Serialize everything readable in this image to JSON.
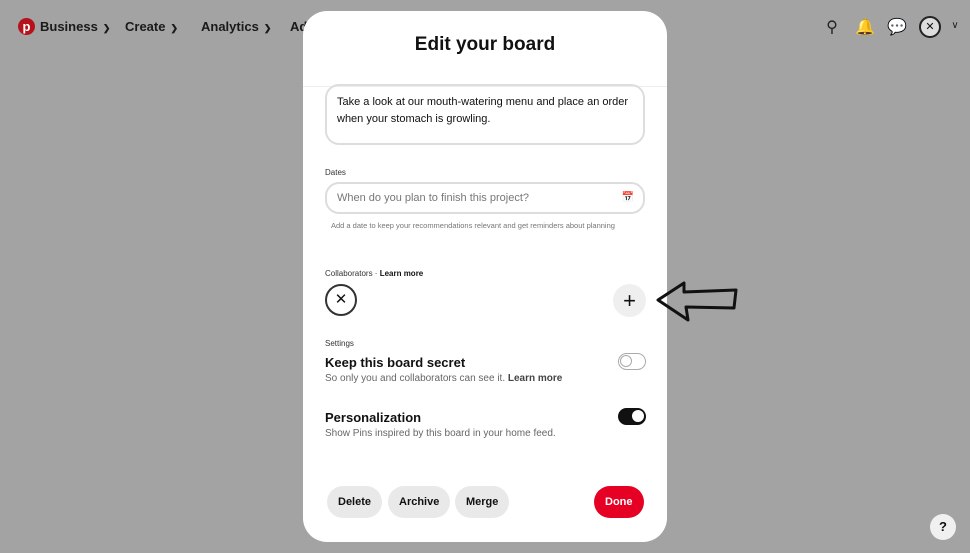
{
  "nav": {
    "items": [
      "Business",
      "Create",
      "Analytics",
      "Ad"
    ]
  },
  "modal": {
    "title": "Edit your board",
    "description": "Take a look at our mouth-watering menu and place an order when your stomach is growling.",
    "dates_label": "Dates",
    "dates_placeholder": "When do you plan to finish this project?",
    "dates_hint": "Add a date to keep your recommendations relevant and get reminders about planning",
    "collaborators_label": "Collaborators · ",
    "collaborators_link": "Learn more",
    "settings_label": "Settings",
    "secret_title": "Keep this board secret",
    "secret_sub": "So only you and collaborators can see it. ",
    "secret_link": "Learn more",
    "secret_on": false,
    "personalization_title": "Personalization",
    "personalization_sub": "Show Pins inspired by this board in your home feed.",
    "personalization_on": true,
    "buttons": {
      "delete": "Delete",
      "archive": "Archive",
      "merge": "Merge",
      "done": "Done"
    }
  },
  "help": "?",
  "colors": {
    "brand": "#e60023",
    "overlay": "#a3a3a3"
  }
}
